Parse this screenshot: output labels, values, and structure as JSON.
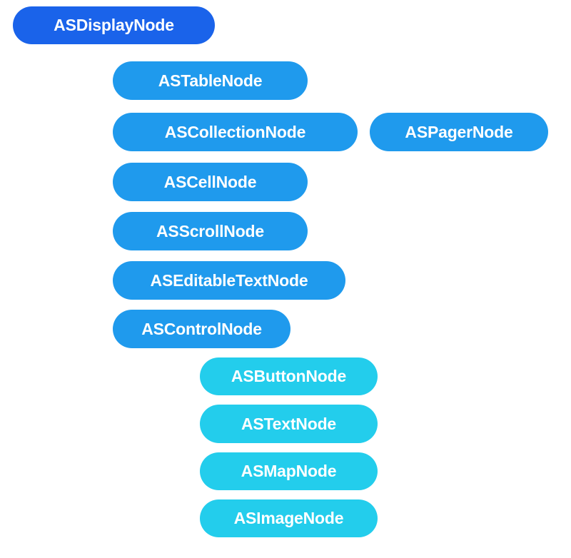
{
  "colors": {
    "root": "#1a63ea",
    "level1": "#1f9aed",
    "level2": "#23cdec",
    "text": "#ffffff"
  },
  "nodes": {
    "display": {
      "label": "ASDisplayNode"
    },
    "table": {
      "label": "ASTableNode"
    },
    "collection": {
      "label": "ASCollectionNode"
    },
    "pager": {
      "label": "ASPagerNode"
    },
    "cell": {
      "label": "ASCellNode"
    },
    "scroll": {
      "label": "ASScrollNode"
    },
    "editable": {
      "label": "ASEditableTextNode"
    },
    "control": {
      "label": "ASControlNode"
    },
    "button": {
      "label": "ASButtonNode"
    },
    "text": {
      "label": "ASTextNode"
    },
    "map": {
      "label": "ASMapNode"
    },
    "image": {
      "label": "ASImageNode"
    }
  }
}
